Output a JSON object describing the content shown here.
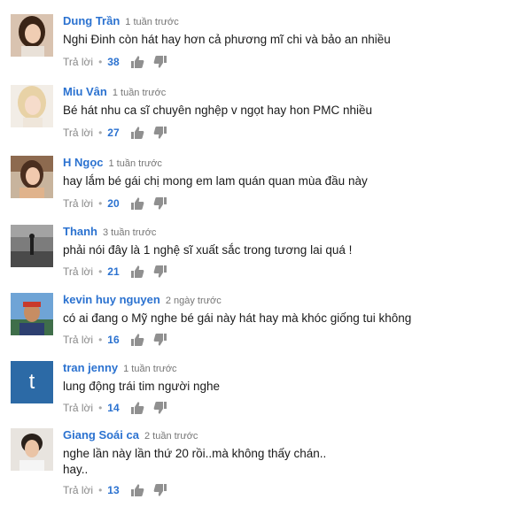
{
  "ui": {
    "reply_label": "Trả lời",
    "separator": "•"
  },
  "comments": [
    {
      "author": "Dung Trần",
      "time": "1 tuần trước",
      "text": "Nghi Đinh còn hát hay hơn cả phương mĩ chi và bảo an nhiều",
      "likes": "38"
    },
    {
      "author": "Miu Vân",
      "time": "1 tuần trước",
      "text": "Bé hát nhu ca sĩ  chuyên nghệp v  ngọt hay hon PMC nhiều",
      "likes": "27"
    },
    {
      "author": "H Ngọc",
      "time": "1 tuần trước",
      "text": "hay lắm bé gái chị mong em lam quán quan mùa đầu này",
      "likes": "20"
    },
    {
      "author": "Thanh",
      "time": "3 tuần trước",
      "text": "phải nói đây là 1 nghệ sĩ xuất sắc trong tương lai quá !",
      "likes": "21"
    },
    {
      "author": "kevin huy nguyen",
      "time": "2 ngày trước",
      "text": "có ai đang o Mỹ nghe bé gái này hát hay mà khóc giống tui không",
      "likes": "16"
    },
    {
      "author": "tran jenny",
      "time": "1 tuần trước",
      "text": "lung động trái tim người nghe",
      "likes": "14",
      "avatar_letter": "t"
    },
    {
      "author": "Giang Soái ca",
      "time": "2 tuần trước",
      "text": "nghe lần này lần thứ 20 rồi..mà không thấy chán..",
      "text2": "hay..",
      "likes": "13"
    }
  ],
  "colors": {
    "author": "#2b72d0",
    "meta": "#767676",
    "icon": "#909090",
    "letter_avatar_bg": "#2c6aa6"
  },
  "icons": {
    "like": "thumbs-up-icon",
    "dislike": "thumbs-down-icon"
  }
}
